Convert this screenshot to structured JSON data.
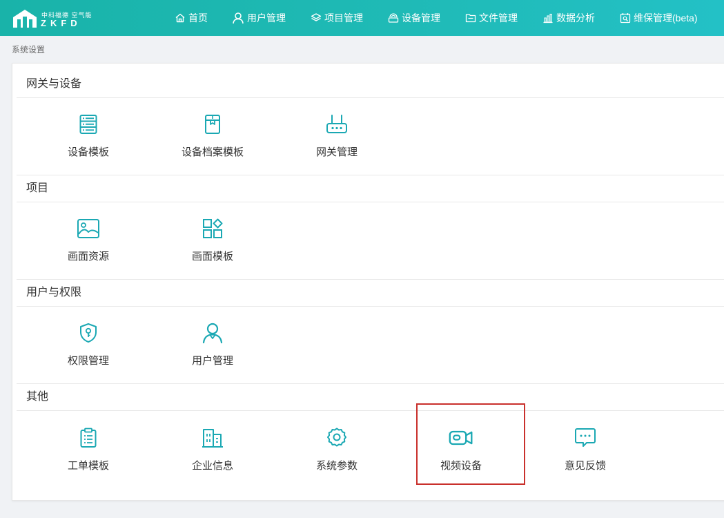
{
  "brand": {
    "logo_cn": "中科福德 空气能",
    "logo_en": "ZKFD"
  },
  "nav": [
    {
      "label": "首页",
      "icon": "home-icon"
    },
    {
      "label": "用户管理",
      "icon": "user-icon"
    },
    {
      "label": "项目管理",
      "icon": "layers-icon"
    },
    {
      "label": "设备管理",
      "icon": "device-icon"
    },
    {
      "label": "文件管理",
      "icon": "folder-icon"
    },
    {
      "label": "数据分析",
      "icon": "bar-chart-icon"
    },
    {
      "label": "维保管理(beta)",
      "icon": "maintenance-icon"
    }
  ],
  "breadcrumb": "系统设置",
  "sections": [
    {
      "title": "网关与设备",
      "items": [
        {
          "label": "设备模板",
          "icon": "server-list-icon"
        },
        {
          "label": "设备档案模板",
          "icon": "archive-icon"
        },
        {
          "label": "网关管理",
          "icon": "gateway-icon"
        }
      ]
    },
    {
      "title": "项目",
      "items": [
        {
          "label": "画面资源",
          "icon": "image-icon"
        },
        {
          "label": "画面模板",
          "icon": "template-grid-icon"
        }
      ]
    },
    {
      "title": "用户与权限",
      "items": [
        {
          "label": "权限管理",
          "icon": "shield-key-icon"
        },
        {
          "label": "用户管理",
          "icon": "user-icon"
        }
      ]
    },
    {
      "title": "其他",
      "items": [
        {
          "label": "工单模板",
          "icon": "clipboard-icon"
        },
        {
          "label": "企业信息",
          "icon": "building-icon"
        },
        {
          "label": "系统参数",
          "icon": "gear-icon"
        },
        {
          "label": "视频设备",
          "icon": "video-camera-icon"
        },
        {
          "label": "意见反馈",
          "icon": "chat-icon"
        }
      ]
    }
  ],
  "colors": {
    "accent": "#1db5ad",
    "icon": "#1aa8b3",
    "highlight_border": "#c9302c",
    "page_bg": "#f0f2f5"
  }
}
